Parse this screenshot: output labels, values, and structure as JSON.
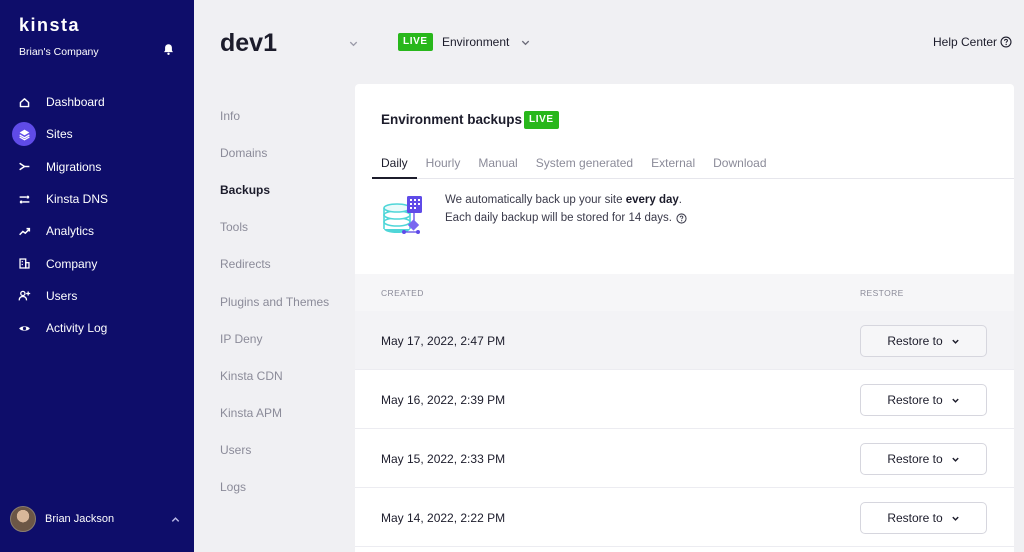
{
  "sidebar": {
    "logo": "kinsta",
    "company": "Brian's Company",
    "items": [
      {
        "label": "Dashboard",
        "icon": "home-icon"
      },
      {
        "label": "Sites",
        "icon": "layers-icon",
        "active": true
      },
      {
        "label": "Migrations",
        "icon": "migrations-icon"
      },
      {
        "label": "Kinsta DNS",
        "icon": "dns-icon"
      },
      {
        "label": "Analytics",
        "icon": "trend-icon"
      },
      {
        "label": "Company",
        "icon": "building-icon"
      },
      {
        "label": "Users",
        "icon": "add-user-icon"
      },
      {
        "label": "Activity Log",
        "icon": "eye-icon"
      }
    ],
    "user_name": "Brian Jackson"
  },
  "header": {
    "site_name": "dev1",
    "env_badge": "LIVE",
    "env_label": "Environment",
    "help_label": "Help Center"
  },
  "subnav": {
    "items": [
      {
        "label": "Info"
      },
      {
        "label": "Domains"
      },
      {
        "label": "Backups",
        "active": true
      },
      {
        "label": "Tools"
      },
      {
        "label": "Redirects"
      },
      {
        "label": "Plugins and Themes"
      },
      {
        "label": "IP Deny"
      },
      {
        "label": "Kinsta CDN"
      },
      {
        "label": "Kinsta APM"
      },
      {
        "label": "Users"
      },
      {
        "label": "Logs"
      }
    ]
  },
  "panel": {
    "title": "Environment backups",
    "badge": "LIVE",
    "tabs": [
      "Daily",
      "Hourly",
      "Manual",
      "System generated",
      "External",
      "Download"
    ],
    "active_tab": "Daily",
    "info": {
      "line1_prefix": "We automatically back up your site ",
      "line1_bold": "every day",
      "line1_suffix": ".",
      "line2": "Each daily backup will be stored for 14 days."
    },
    "table": {
      "col_created": "CREATED",
      "col_restore": "RESTORE",
      "rows": [
        {
          "created": "May 17, 2022, 2:47 PM",
          "action": "Restore to"
        },
        {
          "created": "May 16, 2022, 2:39 PM",
          "action": "Restore to"
        },
        {
          "created": "May 15, 2022, 2:33 PM",
          "action": "Restore to"
        },
        {
          "created": "May 14, 2022, 2:22 PM",
          "action": "Restore to"
        }
      ]
    }
  },
  "colors": {
    "sidebar_bg": "#0e0d6a",
    "accent": "#5f4be8",
    "live_green": "#28b71b"
  }
}
